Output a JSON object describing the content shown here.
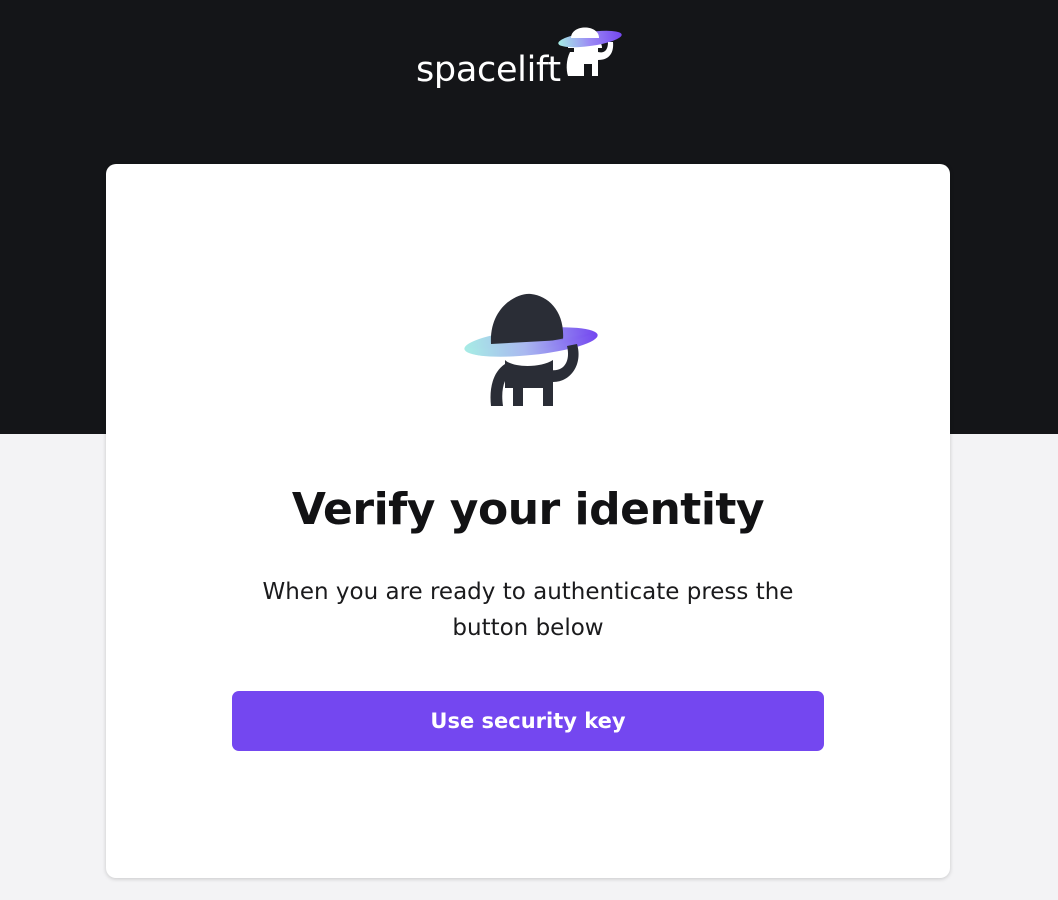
{
  "header": {
    "logo_text": "spacelift",
    "logo_icon": "spacelift-astronaut-icon"
  },
  "card": {
    "illustration_icon": "spacelift-astronaut-icon",
    "title": "Verify your identity",
    "description": "When you are ready to authenticate press the button below",
    "button_label": "Use security key"
  },
  "colors": {
    "top_background": "#141518",
    "page_background": "#f3f3f5",
    "card_background": "#ffffff",
    "accent": "#7447f0",
    "ring_teal": "#9be8e4",
    "ring_purple": "#7447f0",
    "figure_dark": "#2a2d36"
  }
}
